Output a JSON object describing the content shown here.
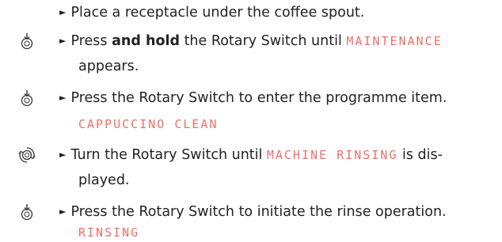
{
  "steps": [
    {
      "icon": "none",
      "bullet": "►",
      "text": "Place a receptacle under the coffee spout."
    },
    {
      "icon": "press-switch-icon",
      "bullet": "►",
      "text_1": "Press ",
      "text_bold": "and hold",
      "text_2": " the Rotary Switch until ",
      "display": "MAINTENANCE",
      "continuation": "appears."
    },
    {
      "icon": "press-switch-icon",
      "bullet": "►",
      "text": "Press the Rotary Switch to enter the programme item.",
      "display_line": "CAPPUCCINO CLEAN"
    },
    {
      "icon": "rotate-switch-icon",
      "bullet": "►",
      "text_1": "Turn the Rotary Switch until ",
      "display": "MACHINE RINSING",
      "text_2": " is dis-",
      "continuation": "played."
    },
    {
      "icon": "press-switch-icon",
      "bullet": "►",
      "text": "Press the Rotary Switch to initiate the rinse operation.",
      "display_line": "RINSING"
    }
  ],
  "colors": {
    "display_text": "#f06f68",
    "body_text": "#222222"
  }
}
